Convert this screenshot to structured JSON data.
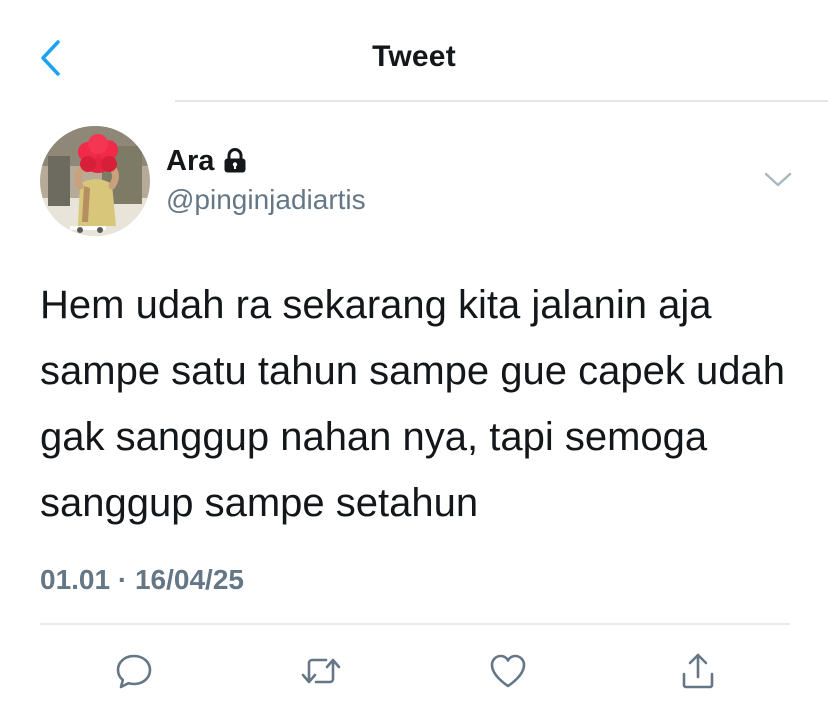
{
  "nav": {
    "title": "Tweet",
    "back_icon": "chevron-left-icon",
    "accent_color": "#1da1f2"
  },
  "author": {
    "name": "Ara",
    "handle": "@pinginjadiartis",
    "protected_icon": "lock-icon",
    "menu_icon": "chevron-down-icon"
  },
  "tweet": {
    "text": "Hem udah ra sekarang kita jalanin aja sampe satu tahun sampe gue capek udah gak sanggup nahan nya, tapi semoga sanggup sampe setahun",
    "time": "01.01",
    "separator": "·",
    "date": "16/04/25"
  },
  "actions": [
    {
      "name": "reply",
      "icon": "reply-icon"
    },
    {
      "name": "retweet",
      "icon": "retweet-icon"
    },
    {
      "name": "like",
      "icon": "heart-icon"
    },
    {
      "name": "share",
      "icon": "share-icon"
    }
  ],
  "colors": {
    "text": "#14171a",
    "secondary": "#657786",
    "divider": "#e4e6e8"
  }
}
